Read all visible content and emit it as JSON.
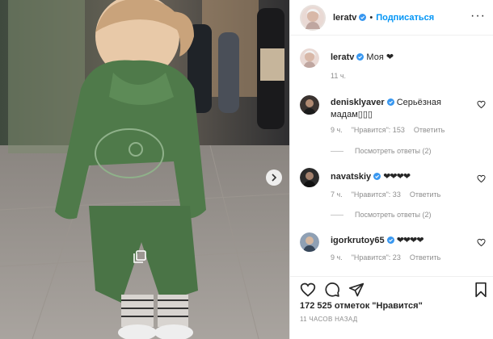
{
  "post": {
    "username": "leratv",
    "follow_label": "Подписаться",
    "dot": "•",
    "more_label": "···",
    "caption": "Моя ❤",
    "caption_time": "11 ч.",
    "likes": "172 525 отметок \"Нравится\"",
    "time_ago": "11 ЧАСОВ НАЗАД"
  },
  "comments": [
    {
      "username": "denisklyаver",
      "text": "Серьёзная мадам▯▯▯",
      "time": "9 ч.",
      "likes": "\"Нравится\": 153",
      "reply_label": "Ответить",
      "view_replies": "Посмотреть ответы (2)"
    },
    {
      "username": "navatskiy",
      "text": "❤❤❤❤",
      "time": "7 ч.",
      "likes": "\"Нравится\": 33",
      "reply_label": "Ответить",
      "view_replies": "Посмотреть ответы (2)"
    },
    {
      "username": "igorkrutoy65",
      "text": "❤❤❤❤",
      "time": "9 ч.",
      "likes": "\"Нравится\": 23",
      "reply_label": "Ответить"
    }
  ],
  "icons": {
    "verified_color": "#3897f0",
    "link_color": "#0095f6"
  }
}
